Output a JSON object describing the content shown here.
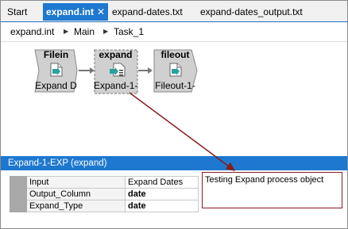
{
  "tabs": [
    {
      "label": "Start"
    },
    {
      "label": "expand.int",
      "close": "✕"
    },
    {
      "label": "expand-dates.txt"
    },
    {
      "label": "expand-dates_output.txt"
    }
  ],
  "breadcrumb": [
    "expand.int",
    "Main",
    "Task_1"
  ],
  "breadcrumb_separator": "▶",
  "nodes": [
    {
      "title": "Filein",
      "label": "Expand D"
    },
    {
      "title": "expand",
      "label": "Expand-1-"
    },
    {
      "title": "fileout",
      "label": "Fileout-1-"
    }
  ],
  "properties": {
    "title": "Expand-1-EXP (expand)",
    "rows": [
      {
        "name": "Input",
        "value": "Expand Dates"
      },
      {
        "name": "Output_Column",
        "value": "date"
      },
      {
        "name": "Expand_Type",
        "value": "date"
      }
    ],
    "description": "Testing Expand process object"
  },
  "colors": {
    "accent": "#1e78d0",
    "annotation": "#8b1a1a",
    "node_fill": "#d0d0d0",
    "doc_icon": "#2aa19b"
  }
}
